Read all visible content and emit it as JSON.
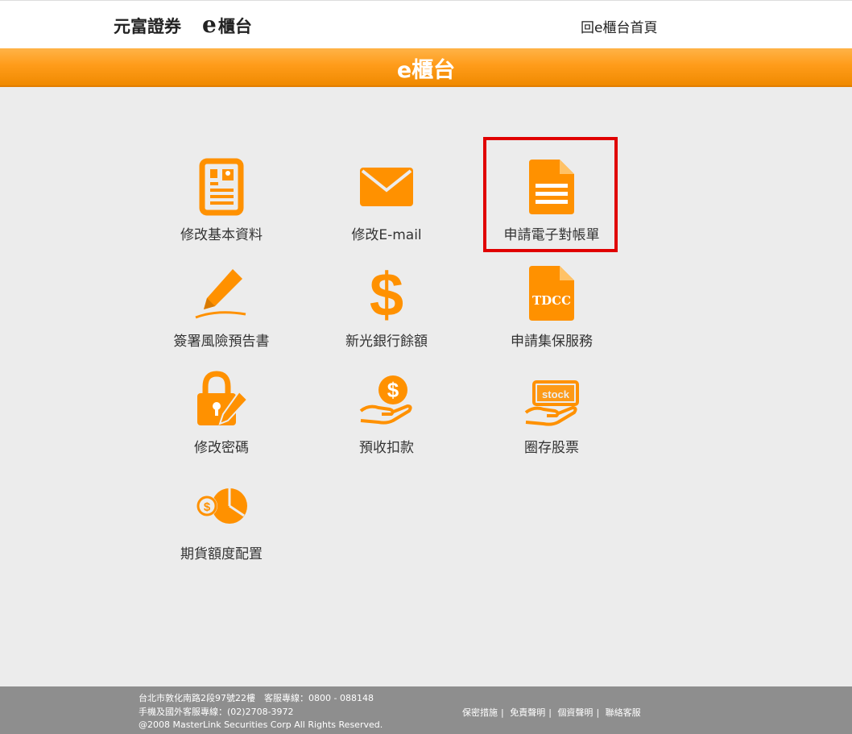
{
  "header": {
    "brand_name": "元富證券",
    "brand_e": "e",
    "brand_sub": "櫃台",
    "home_link": "回e櫃台首頁"
  },
  "titlebar": {
    "title": "e櫃台"
  },
  "colors": {
    "accent": "#ff9100",
    "highlight": "#e00000",
    "footer_bg": "#8e8e8e"
  },
  "menu": {
    "items": [
      {
        "label": "修改基本資料",
        "icon": "profile-card-icon"
      },
      {
        "label": "修改E-mail",
        "icon": "envelope-icon"
      },
      {
        "label": "申請電子對帳單",
        "icon": "document-icon"
      },
      {
        "label": "簽署風險預告書",
        "icon": "pen-sign-icon"
      },
      {
        "label": "新光銀行餘額",
        "icon": "dollar-icon"
      },
      {
        "label": "申請集保服務",
        "icon": "tdcc-document-icon",
        "icon_text": "TDCC"
      },
      {
        "label": "修改密碼",
        "icon": "lock-pen-icon"
      },
      {
        "label": "預收扣款",
        "icon": "hand-money-icon"
      },
      {
        "label": "圈存股票",
        "icon": "hand-stock-icon",
        "icon_text": "stock"
      },
      {
        "label": "期貨額度配置",
        "icon": "coin-pie-icon"
      }
    ]
  },
  "footer": {
    "address": "台北市敦化南路2段97號22樓　客服專線：0800 - 088148",
    "phone": "手機及國外客服專線：(02)2708-3972",
    "copyright": "@2008 MasterLink Securities Corp All Rights Reserved.",
    "links": [
      "保密措施",
      "免責聲明",
      "個資聲明",
      "聯絡客服"
    ],
    "separator": "|"
  }
}
